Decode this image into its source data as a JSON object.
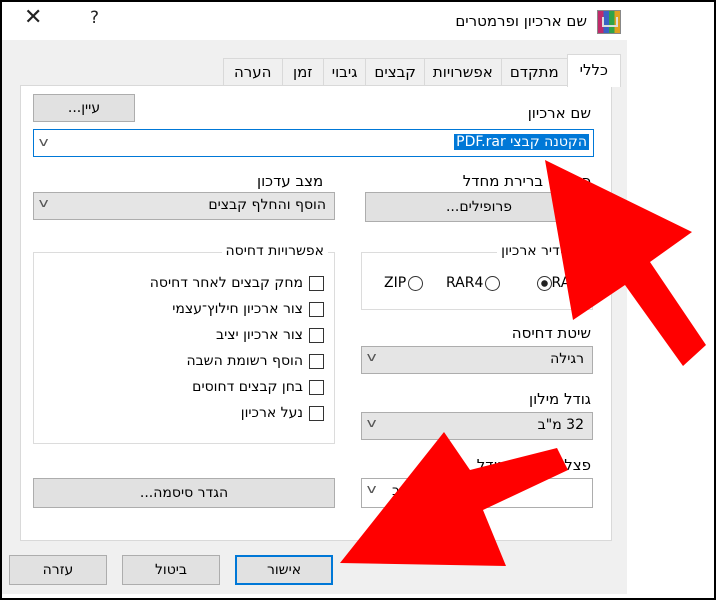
{
  "window": {
    "title": "שם ארכיון ופרמטרים",
    "app_icon": "winrar-icon",
    "help_label": "?",
    "close_label": "✕"
  },
  "tabs": [
    {
      "label": "כללי",
      "active": true
    },
    {
      "label": "מתקדם"
    },
    {
      "label": "אפשרויות"
    },
    {
      "label": "קבצים"
    },
    {
      "label": "גיבוי"
    },
    {
      "label": "זמן"
    },
    {
      "label": "הערה"
    }
  ],
  "general": {
    "archive_name_label": "שם ארכיון",
    "browse_label": "עיין...",
    "archive_name_value": "הקטנה קבצי PDF.rar",
    "default_profile_label": "פרופיל ברירת מחדל",
    "profiles_button": "פרופילים...",
    "update_mode_label": "מצב עדכון",
    "update_mode_value": "הוסף והחלף קבצים",
    "archive_format_label": "תסדיר ארכיון",
    "formats": [
      {
        "label": "RAR",
        "selected": true
      },
      {
        "label": "RAR4",
        "selected": false
      },
      {
        "label": "ZIP",
        "selected": false
      }
    ],
    "compression_method_label": "שיטת דחיסה",
    "compression_method_value": "רגילה",
    "dictionary_size_label": "גודל מילון",
    "dictionary_size_value": "32 מ\"ב",
    "split_label": "פצל לכרכים, גודל",
    "split_value": "ב",
    "compression_options_title": "אפשרויות דחיסה",
    "options": [
      {
        "label": "מחק קבצים לאחר דחיסה",
        "checked": false
      },
      {
        "label": "צור ארכיון חילוץ־עצמי",
        "checked": false
      },
      {
        "label": "צור ארכיון יציב",
        "checked": false
      },
      {
        "label": "הוסף רשומת השבה",
        "checked": false
      },
      {
        "label": "בחן קבצים דחוסים",
        "checked": false
      },
      {
        "label": "נעל ארכיון",
        "checked": false
      }
    ],
    "set_password_button": "הגדר סיסמה..."
  },
  "footer": {
    "ok": "אישור",
    "cancel": "ביטול",
    "help": "עזרה"
  },
  "annotations": {
    "arrow_color": "#ff0000"
  }
}
